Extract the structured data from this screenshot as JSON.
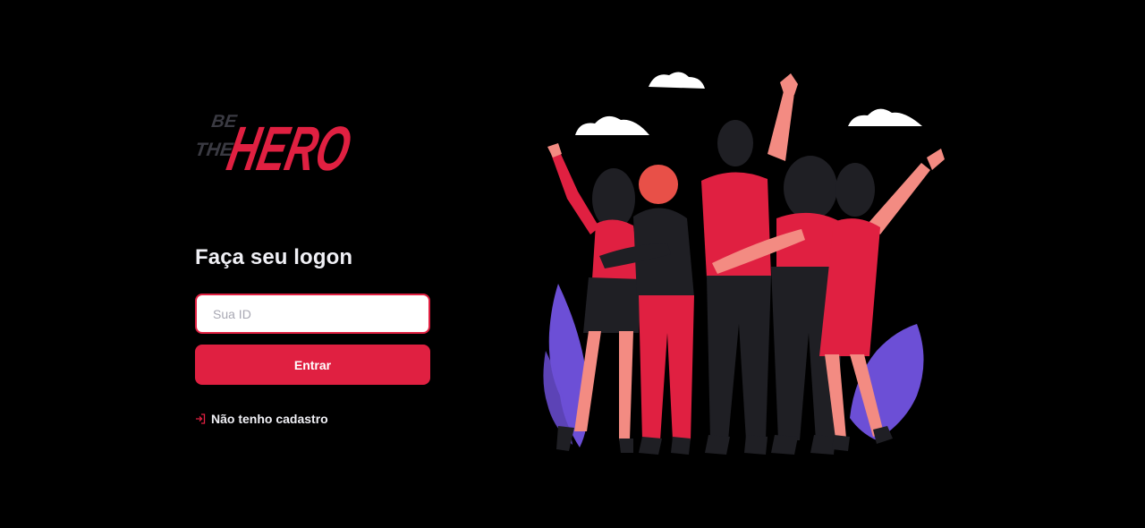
{
  "logo": {
    "be": "BE",
    "the": "THE",
    "hero": "HERO"
  },
  "logon": {
    "title": "Faça seu logon",
    "id_placeholder": "Sua ID",
    "enter_label": "Entrar",
    "register_link": "Não tenho cadastro"
  },
  "colors": {
    "background": "#000000",
    "accent": "#e02041",
    "purple_leaf": "#6c4fd6"
  },
  "icons": {
    "register": "log-in-icon"
  }
}
